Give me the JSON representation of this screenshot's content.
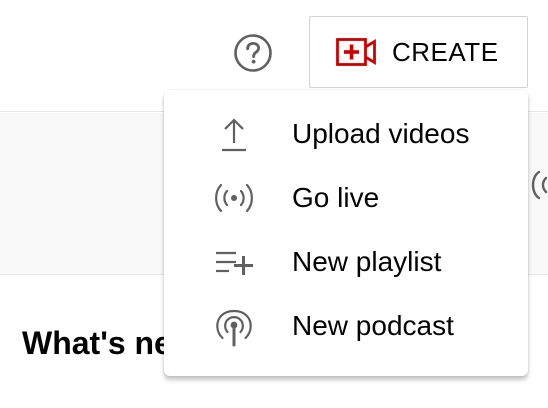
{
  "header": {
    "help_icon": "help-circle-icon",
    "create_button": {
      "label": "CREATE",
      "icon": "video-add-icon",
      "icon_color": "#cc0000"
    }
  },
  "create_menu": {
    "items": [
      {
        "label": "Upload videos",
        "icon": "upload-icon"
      },
      {
        "label": "Go live",
        "icon": "live-broadcast-icon"
      },
      {
        "label": "New playlist",
        "icon": "playlist-add-icon"
      },
      {
        "label": "New podcast",
        "icon": "podcast-icon"
      }
    ]
  },
  "main": {
    "section_title": "What's ne"
  },
  "colors": {
    "icon_gray": "#606060",
    "accent_red": "#cc0000",
    "band_background": "#f9f9f9"
  }
}
